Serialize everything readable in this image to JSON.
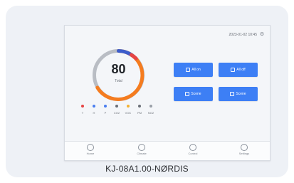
{
  "caption": "KJ-08A1.00-NØRDIS",
  "screen": {
    "topbar": {
      "datetime": "2023-01-02 10:45",
      "settings_icon": "gear-icon"
    },
    "ring": {
      "value": "80",
      "label": "Total",
      "level_percent": 80,
      "colors": {
        "track": "#b9bdc4",
        "progress": "#f57c1f",
        "accent_red": "#e64545",
        "accent_blue": "#3b5ccc"
      }
    },
    "sensors": [
      {
        "label": "T",
        "color": "#e64545"
      },
      {
        "label": "H",
        "color": "#4a7ef0"
      },
      {
        "label": "P",
        "color": "#4a7ef0"
      },
      {
        "label": "CO2",
        "color": "#6b7078"
      },
      {
        "label": "VOC",
        "color": "#f2b233"
      },
      {
        "label": "PM",
        "color": "#6b7078"
      },
      {
        "label": "NO2",
        "color": "#9aa0a8"
      }
    ],
    "buttons": [
      {
        "label": "All on",
        "icon": "power-icon"
      },
      {
        "label": "All off",
        "icon": "power-off-icon"
      },
      {
        "label": "Scene",
        "icon": "scene-icon"
      },
      {
        "label": "Scene",
        "icon": "scene-icon"
      }
    ],
    "nav": [
      {
        "label": "Home",
        "icon": "home-icon"
      },
      {
        "label": "Climate",
        "icon": "climate-icon"
      },
      {
        "label": "Control",
        "icon": "control-icon"
      },
      {
        "label": "Settings",
        "icon": "settings-icon"
      }
    ]
  }
}
